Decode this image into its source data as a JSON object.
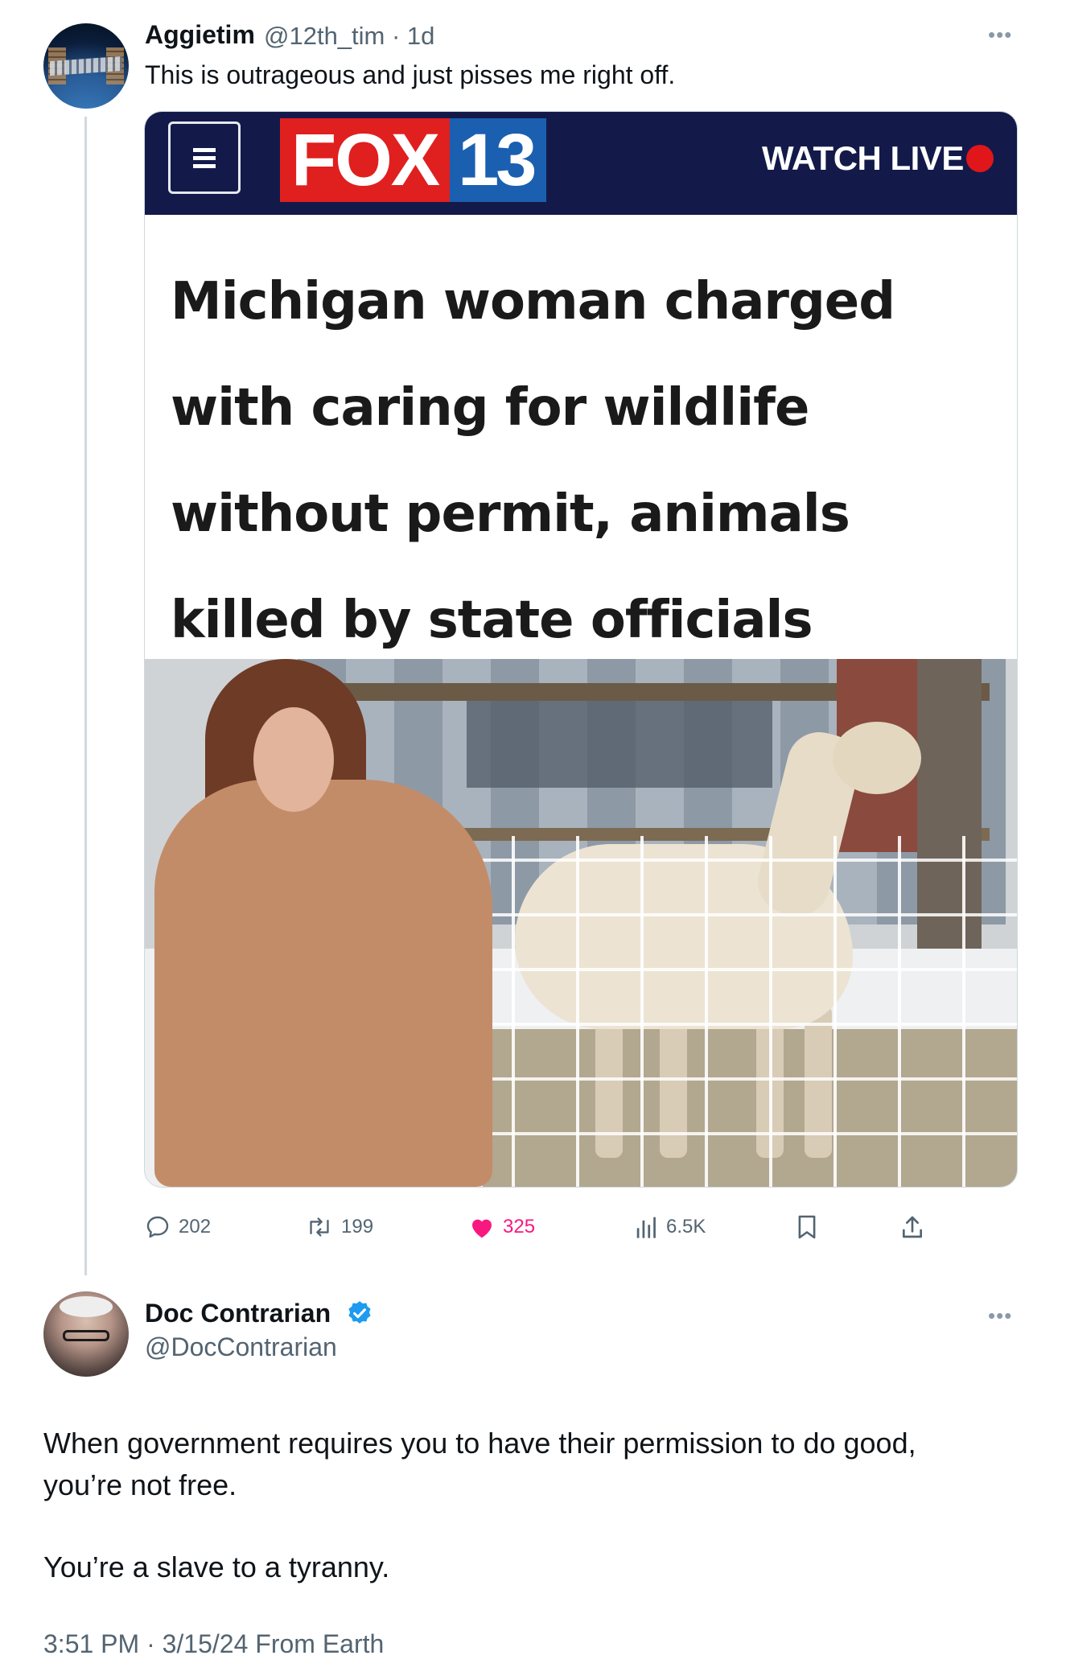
{
  "tweet": {
    "author_name": "Aggietim",
    "handle_time": "@12th_tim · 1d",
    "more_icon": "more-icon",
    "text": "This is outrageous and just pisses me right off.",
    "card": {
      "brand_fox": "FOX",
      "brand_num": "13",
      "watch_live": "WATCH LIVE",
      "headline": "Michigan woman charged with caring for wildlife without permit, animals killed by state officials",
      "live_color": "#e0161b",
      "header_color": "#131a4a"
    },
    "actions": {
      "replies": "202",
      "reposts": "199",
      "likes": "325",
      "views": "6.5K"
    },
    "like_color": "#f91880"
  },
  "reply": {
    "author_name": "Doc Contrarian",
    "handle": "@DocContrarian",
    "verified": true,
    "verified_color": "#1d9bf0",
    "body_line1": "When government requires you to have their permission to do good,",
    "body_line2": "you’re not free.",
    "body_line3": "You’re a slave to a tyranny.",
    "timestamp": "3:51 PM · 3/15/24 From Earth"
  }
}
